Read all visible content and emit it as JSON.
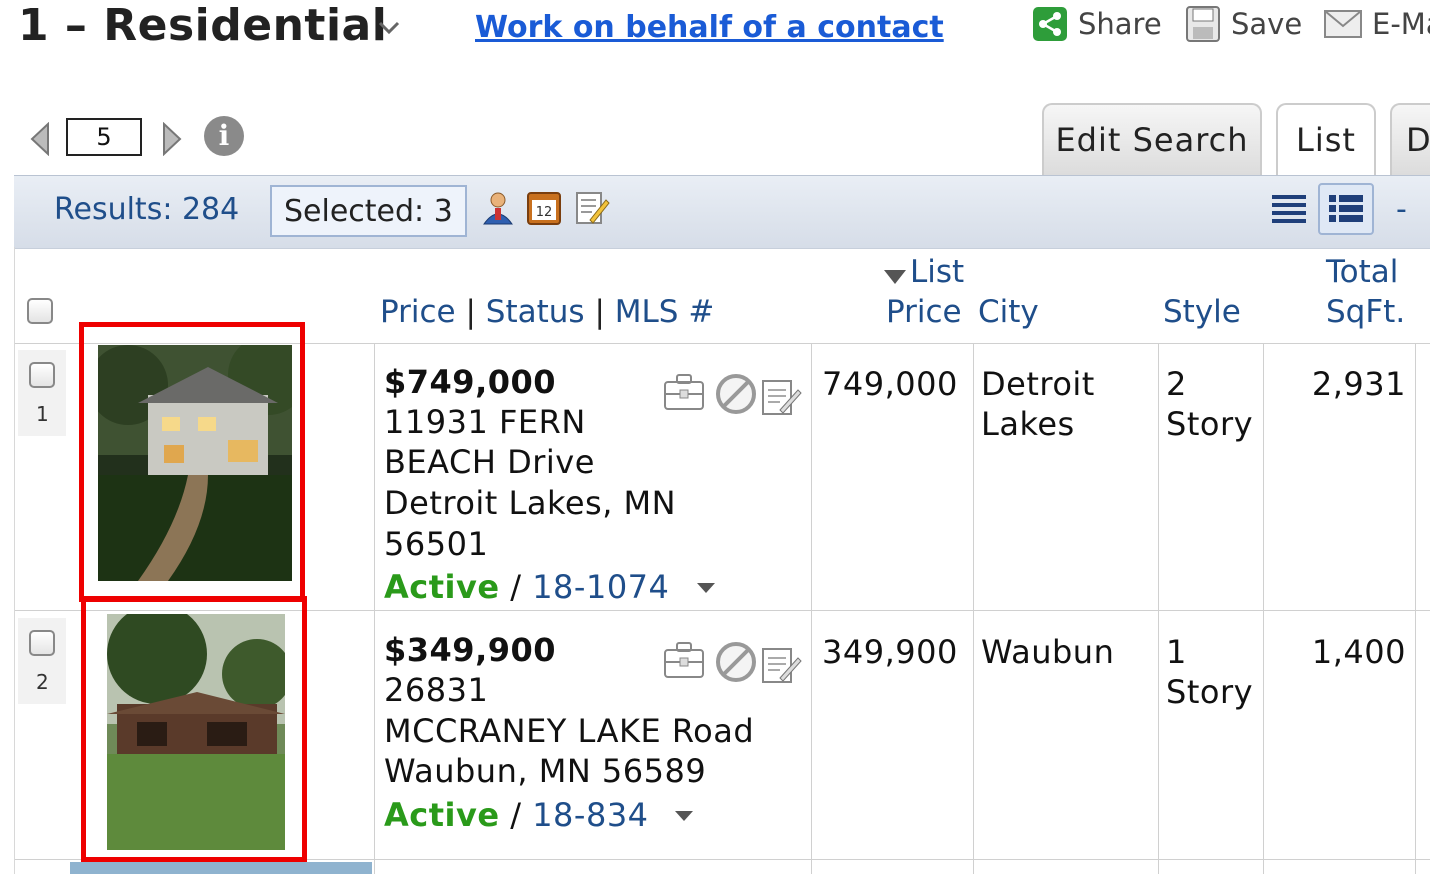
{
  "header": {
    "title": "1 – Residential",
    "behalf_link": "Work on behalf of a contact",
    "actions": [
      {
        "label": "Share",
        "icon": "share-icon"
      },
      {
        "label": "Save",
        "icon": "save-icon"
      },
      {
        "label": "E-Ma",
        "icon": "email-icon"
      }
    ]
  },
  "pager": {
    "page": "5"
  },
  "tabs": [
    {
      "label": "Edit Search"
    },
    {
      "label": "List"
    },
    {
      "label": "D"
    }
  ],
  "toolbar": {
    "results": "Results: 284",
    "selected": "Selected: 3",
    "icons": [
      "contact-icon",
      "calendar-icon",
      "edit-note-icon"
    ],
    "views": [
      "list-view-icon",
      "detail-view-icon"
    ]
  },
  "columns": {
    "price": "Price",
    "sep1": "|",
    "status": "Status",
    "sep2": "|",
    "mls": "MLS #",
    "list_price_line1": "List",
    "list_price_line2": "Price",
    "city": "City",
    "style": "Style",
    "sqft_line1": "Total",
    "sqft_line2": "SqFt."
  },
  "rows": [
    {
      "num": "1",
      "price": "$749,000",
      "address_lines": [
        "11931 FERN",
        "BEACH Drive",
        "Detroit Lakes, MN",
        "56501"
      ],
      "status": "Active",
      "slash": "/",
      "mls": "18-1074",
      "list_price": "749,000",
      "city_lines": [
        "Detroit",
        "Lakes"
      ],
      "style_lines": [
        "2",
        "Story"
      ],
      "sqft": "2,931"
    },
    {
      "num": "2",
      "price": "$349,900",
      "address_lines": [
        "26831",
        "MCCRANEY LAKE Road",
        "Waubun, MN 56589"
      ],
      "status": "Active",
      "slash": "/",
      "mls": "18-834",
      "list_price": "349,900",
      "city_lines": [
        "Waubun"
      ],
      "style_lines": [
        "1",
        "Story"
      ],
      "sqft": "1,400"
    }
  ],
  "colors": {
    "link": "#1a5bd6",
    "header_text": "#1f4e8a",
    "active": "#2a9a1a",
    "highlight": "#e00000"
  }
}
